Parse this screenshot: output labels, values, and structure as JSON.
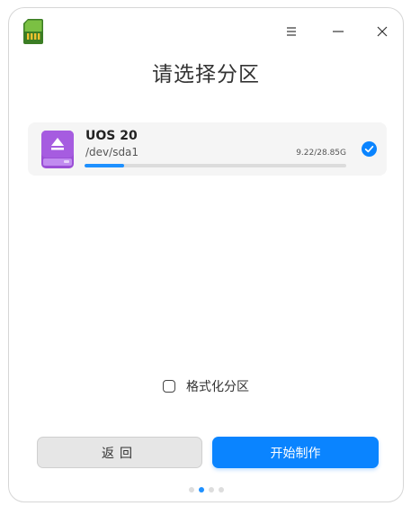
{
  "window": {
    "title": "请选择分区",
    "controls": {
      "menu_icon": "hamburger-menu-icon",
      "minimize_icon": "minimize-icon",
      "close_icon": "close-icon"
    }
  },
  "partition": {
    "name": "UOS 20",
    "device": "/dev/sda1",
    "size": "9.22/28.85G",
    "usage_fraction": 0.15,
    "selected": true,
    "icon": "usb-disk-icon"
  },
  "format_option": {
    "label": "格式化分区",
    "checked": false
  },
  "buttons": {
    "back_label": "返回",
    "start_label": "开始制作"
  },
  "pager": {
    "total": 4,
    "current": 2
  },
  "colors": {
    "accent": "#0a84ff",
    "disk_purple": "#9b4fd6",
    "card_bg": "#f5f5f5"
  }
}
